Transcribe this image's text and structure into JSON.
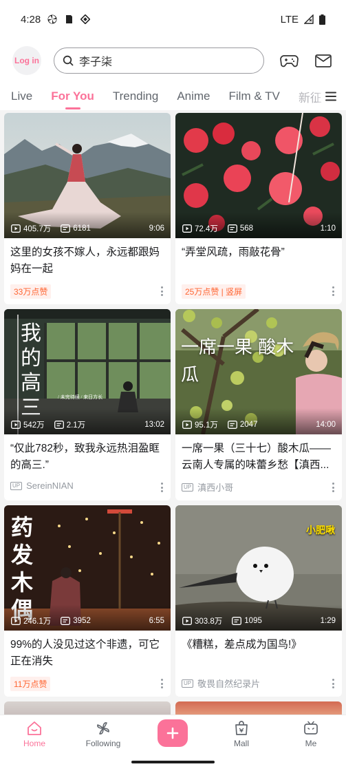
{
  "status_bar": {
    "time": "4:28",
    "network": "LTE"
  },
  "header": {
    "login_label": "Log in",
    "search_value": "李子柒"
  },
  "tabs": [
    {
      "label": "Live",
      "active": false
    },
    {
      "label": "For You",
      "active": true
    },
    {
      "label": "Trending",
      "active": false
    },
    {
      "label": "Anime",
      "active": false
    },
    {
      "label": "Film & TV",
      "active": false
    },
    {
      "label": "新征",
      "active": false
    }
  ],
  "cards": [
    {
      "views": "405.7万",
      "comments": "6181",
      "duration": "9:06",
      "title": "这里的女孩不嫁人，永远都跟妈妈在一起",
      "badge": "33万点赞",
      "uploader": ""
    },
    {
      "views": "72.4万",
      "comments": "568",
      "duration": "1:10",
      "title": "“弄堂风疏，雨敲花骨”",
      "badge": "25万点赞 | 竖屏",
      "uploader": ""
    },
    {
      "views": "542万",
      "comments": "2.1万",
      "duration": "13:02",
      "title": "“仅此782秒，致我永远热泪盈眶的高三.”",
      "badge": "",
      "uploader": "SereinNIAN",
      "overlay_text": "我的高三"
    },
    {
      "views": "95.1万",
      "comments": "2047",
      "duration": "14:00",
      "title": "一席一果（三十七）酸木瓜——云南人专属的味蕾乡愁【滇西...",
      "badge": "",
      "uploader": "滇西小哥",
      "overlay_text": "一席一果 酸木瓜"
    },
    {
      "views": "246.1万",
      "comments": "3952",
      "duration": "6:55",
      "title": "99%的人没见过这个非遗，可它正在消失",
      "badge": "11万点赞",
      "uploader": "",
      "overlay_text": "药发木偶"
    },
    {
      "views": "303.8万",
      "comments": "1095",
      "duration": "1:29",
      "title": "《糟糕，差点成为国鸟!》",
      "badge": "",
      "uploader": "敬畏自然纪录片",
      "overlay_text": "小肥啾"
    }
  ],
  "up_tag": "UP",
  "bottom_nav": {
    "home": "Home",
    "following": "Following",
    "mall": "Mall",
    "me": "Me"
  },
  "colors": {
    "accent": "#fb7299",
    "badge_text": "#ff6633"
  }
}
